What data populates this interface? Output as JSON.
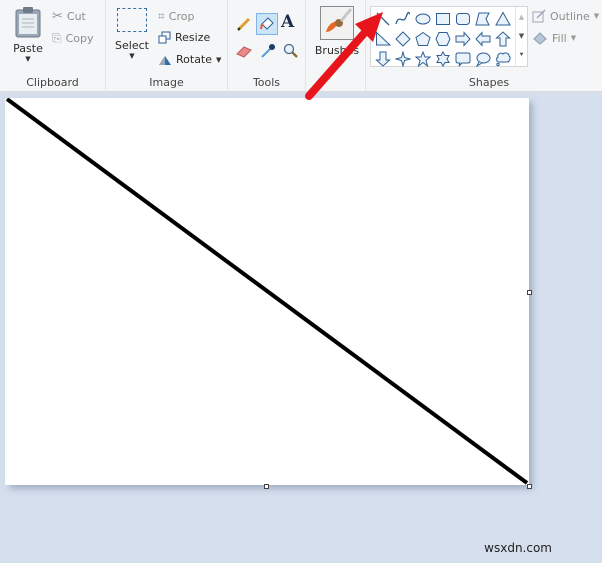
{
  "ribbon": {
    "clipboard": {
      "label": "Clipboard",
      "paste": "Paste",
      "cut": "Cut",
      "copy": "Copy"
    },
    "image": {
      "label": "Image",
      "select": "Select",
      "crop": "Crop",
      "resize": "Resize",
      "rotate": "Rotate"
    },
    "tools": {
      "label": "Tools",
      "items": [
        "pencil-icon",
        "fill-icon",
        "text-icon",
        "eraser-icon",
        "color-picker-icon",
        "magnifier-icon"
      ]
    },
    "brushes": {
      "label": "Brushes"
    },
    "shapes": {
      "label": "Shapes",
      "items": [
        "line",
        "curve",
        "oval",
        "rectangle",
        "rounded-rectangle",
        "polygon",
        "triangle",
        "right-triangle",
        "diamond",
        "pentagon",
        "hexagon",
        "right-arrow",
        "left-arrow",
        "up-arrow",
        "down-arrow",
        "four-point-star",
        "five-point-star",
        "six-point-star",
        "rounded-callout",
        "oval-callout",
        "cloud-callout"
      ],
      "selected": "line",
      "outline": "Outline",
      "fill": "Fill"
    }
  },
  "annotation": {
    "arrow_color": "#e8141c",
    "points_to": "line"
  },
  "canvas": {
    "background": "#ffffff",
    "line_color": "#000000"
  },
  "watermark": "wsxdn.com"
}
